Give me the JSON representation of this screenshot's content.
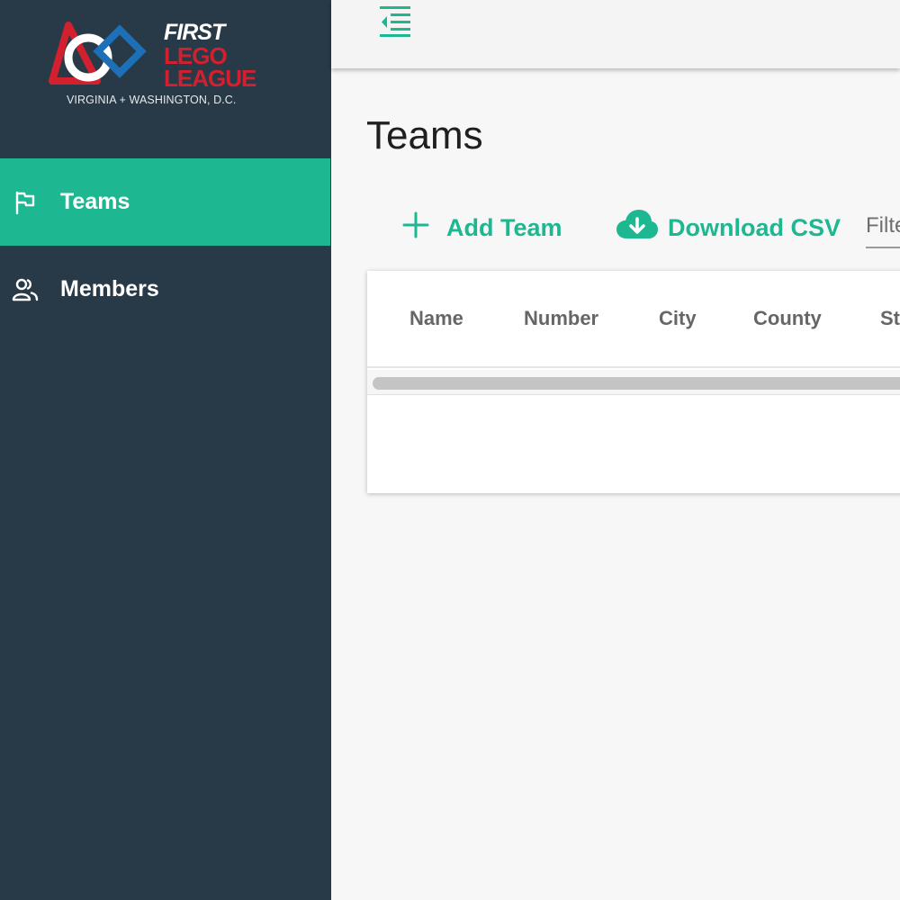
{
  "logo": {
    "first": "FIRST",
    "lego": "LEGO",
    "league": "LEAGUE",
    "region": "VIRGINIA + WASHINGTON, D.C."
  },
  "sidebar": {
    "items": [
      {
        "label": "Teams",
        "icon": "flag-icon",
        "active": true
      },
      {
        "label": "Members",
        "icon": "people-icon",
        "active": false
      }
    ]
  },
  "topbar": {
    "menu_icon": "collapse-menu-icon"
  },
  "main": {
    "title": "Teams",
    "actions": {
      "add_label": "Add Team",
      "download_label": "Download CSV"
    },
    "filter": {
      "placeholder": "Filter"
    },
    "table": {
      "columns": [
        "Name",
        "Number",
        "City",
        "County",
        "St"
      ]
    }
  },
  "colors": {
    "sidebar_bg": "#283a47",
    "accent": "#1db792",
    "brand_red": "#d3202f"
  }
}
